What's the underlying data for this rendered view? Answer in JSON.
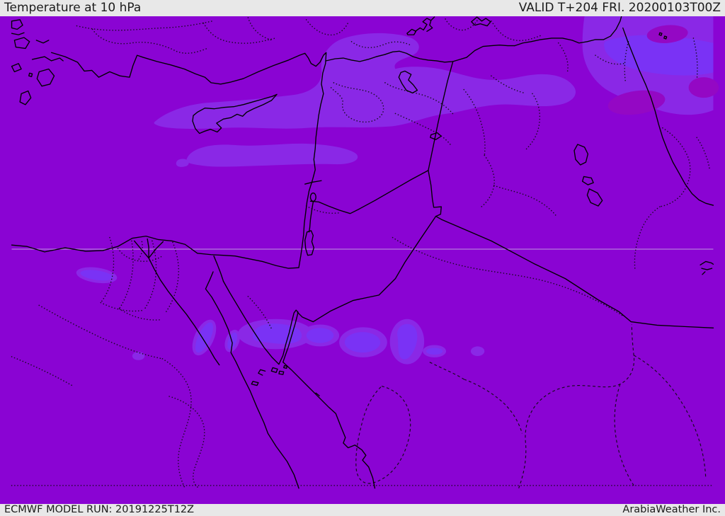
{
  "header": {
    "title": "Temperature at 10 hPa",
    "validity": "VALID T+204 FRI. 20200103T00Z"
  },
  "footer": {
    "model_run": "ECMWF MODEL RUN: 20191225T12Z",
    "credit": "ArabiaWeather Inc."
  },
  "map": {
    "kind": "weather-model-temperature-field",
    "parameter": "Temperature",
    "level": "10 hPa",
    "model": "ECMWF",
    "run_time": "20191225T12Z",
    "valid_time": "20200103T00Z",
    "lead": "T+204",
    "region": "Eastern Mediterranean / Middle East",
    "colors": {
      "base": "#8A04D3",
      "band_light": "#8A28E6",
      "band_bright": "#7A32F5",
      "patch_dark": "#9408C4",
      "coastline": "#000000",
      "latitude_line": "#CDBCE0",
      "bar_bg": "#E8E8E8",
      "bar_text": "#1B1B1B"
    }
  }
}
